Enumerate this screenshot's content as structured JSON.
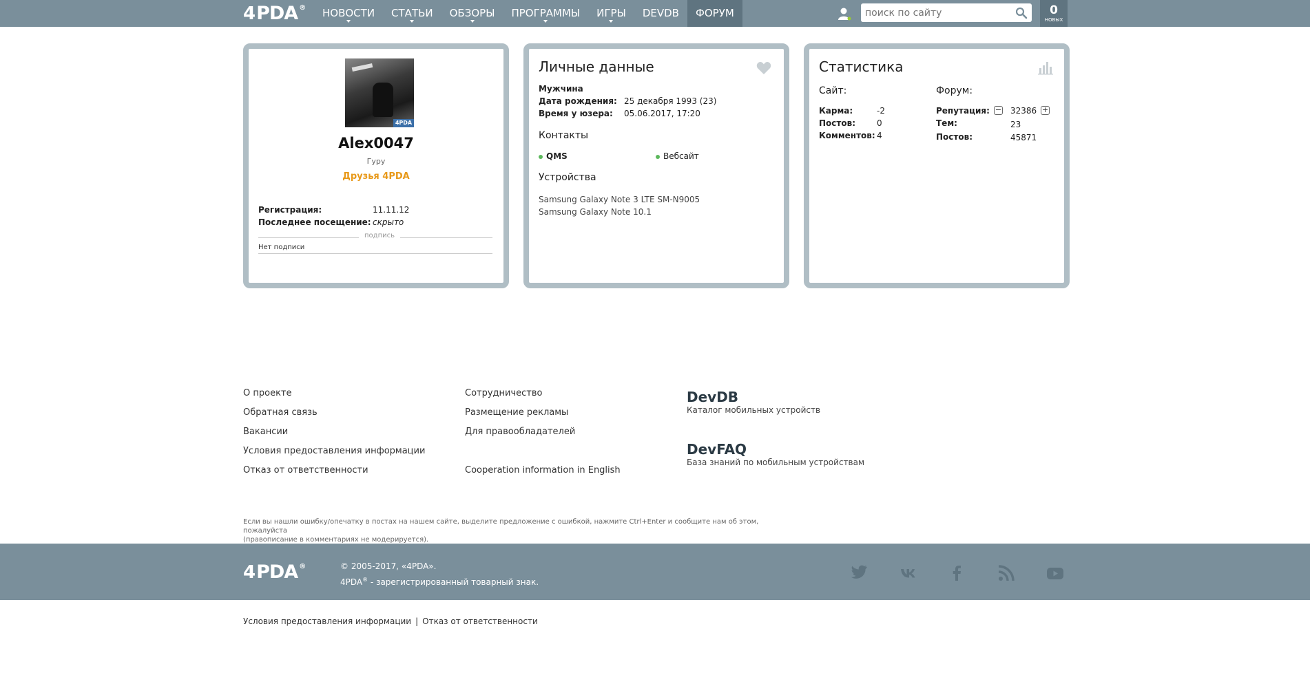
{
  "header": {
    "logo_text": "PDA",
    "logo_number": "4",
    "nav": [
      {
        "label": "НОВОСТИ",
        "dropdown": true
      },
      {
        "label": "СТАТЬИ",
        "dropdown": true
      },
      {
        "label": "ОБЗОРЫ",
        "dropdown": true
      },
      {
        "label": "ПРОГРАММЫ",
        "dropdown": true
      },
      {
        "label": "ИГРЫ",
        "dropdown": true
      },
      {
        "label": "DEVDB",
        "dropdown": false
      },
      {
        "label": "ФОРУМ",
        "dropdown": false,
        "active": true
      }
    ],
    "search_placeholder": "поиск по сайту",
    "new_count": "0",
    "new_label": "НОВЫХ"
  },
  "profile": {
    "avatar_badge": "4PDA",
    "username": "Alex0047",
    "rank": "Гуру",
    "group": "Друзья 4PDA",
    "registration_label": "Регистрация:",
    "registration_value": "11.11.12",
    "last_visit_label": "Последнее посещение:",
    "last_visit_value": "скрыто",
    "signature_label": "подпись",
    "signature_text": "Нет подписи"
  },
  "personal": {
    "title": "Личные данные",
    "gender": "Мужчина",
    "birth_label": "Дата рождения:",
    "birth_value": "25 декабря 1993 (23)",
    "usertime_label": "Время у юзера:",
    "usertime_value": "05.06.2017, 17:20",
    "contacts_title": "Контакты",
    "contact_qms": "QMS",
    "contact_web": "Вебсайт",
    "devices_title": "Устройства",
    "devices": [
      "Samsung Galaxy Note 3 LTE SM-N9005",
      "Samsung Galaxy Note 10.1"
    ]
  },
  "stats": {
    "title": "Статистика",
    "site_title": "Сайт:",
    "forum_title": "Форум:",
    "karma_label": "Карма:",
    "karma_value": "-2",
    "site_posts_label": "Постов:",
    "site_posts_value": "0",
    "comments_label": "Комментов:",
    "comments_value": "4",
    "rep_label": "Репутация:",
    "rep_value": "32386",
    "topics_label": "Тем:",
    "topics_value": "23",
    "forum_posts_label": "Постов:",
    "forum_posts_value": "45871"
  },
  "footer": {
    "col1": [
      "О проекте",
      "Обратная связь",
      "Вакансии",
      "Условия предоставления информации",
      "Отказ от ответственности"
    ],
    "col2": [
      "Сотрудничество",
      "Размещение рекламы",
      "Для правообладателей",
      "Cooperation information in English"
    ],
    "devdb_title": "DevDB",
    "devdb_sub": "Каталог мобильных устройств",
    "devfaq_title": "DevFAQ",
    "devfaq_sub": "База знаний по мобильным устройствам",
    "note_line1": "Если вы нашли ошибку/опечатку в постах на нашем сайте, выделите предложение с ошибкой, нажмите Ctrl+Enter и сообщите нам об этом, пожалуйста",
    "note_line2": "(правописание в комментариях не модерируется).",
    "copyright": "© 2005-2017, «4PDA».",
    "trademark_pre": "4PDA",
    "trademark_post": " - зарегистрированный товарный знак.",
    "bottom_link1": "Условия предоставления информации",
    "bottom_sep": "|",
    "bottom_link2": "Отказ от ответственности"
  },
  "colors": {
    "header": "#7a8f9b",
    "active_nav": "#5f7480",
    "card_border": "#b0bec5",
    "group": "#e8991a",
    "online": "#5cb85c"
  }
}
